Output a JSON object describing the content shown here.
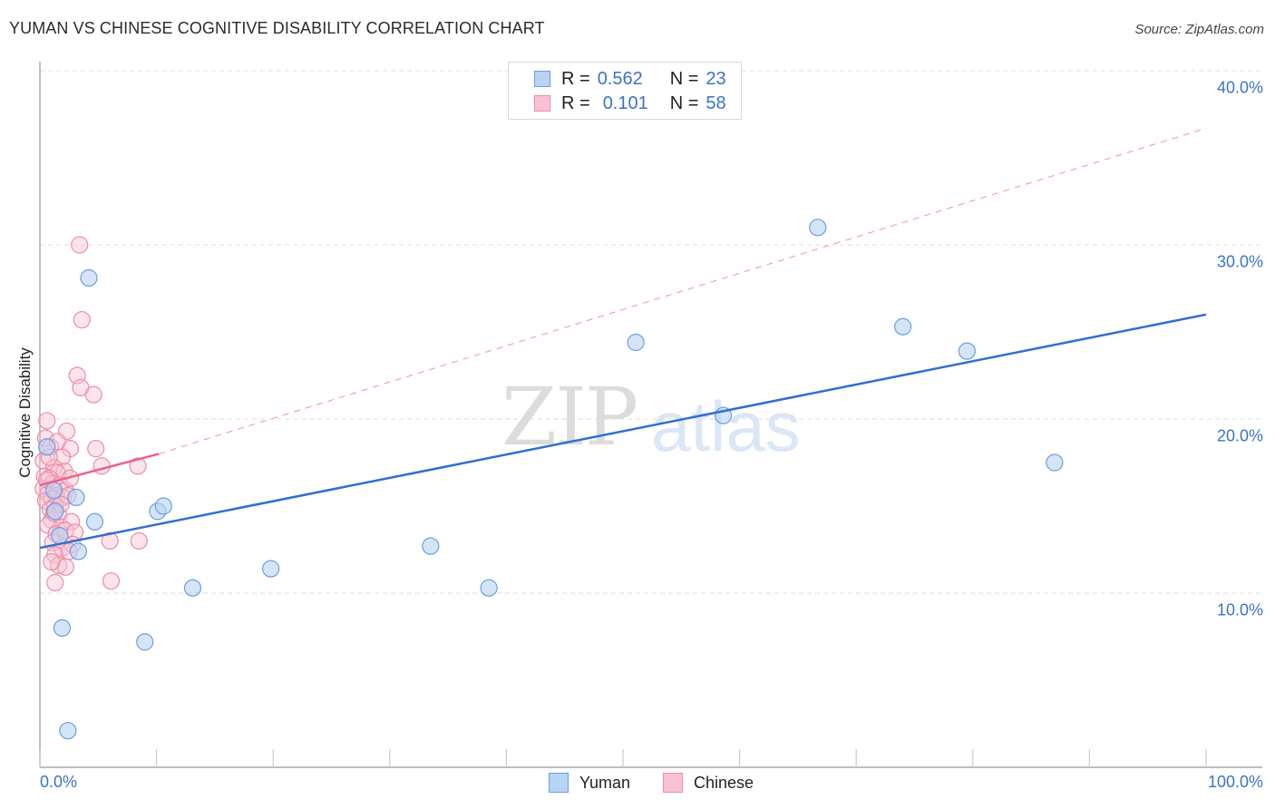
{
  "header": {
    "title": "YUMAN VS CHINESE COGNITIVE DISABILITY CORRELATION CHART",
    "source": "Source: ZipAtlas.com"
  },
  "watermark": {
    "zip": "ZIP",
    "atlas": "atlas"
  },
  "colors": {
    "yuman_fill": "#b9d3f3",
    "yuman_stroke": "#6a9ee0",
    "yuman_line": "#2f6fd0",
    "chinese_fill": "#f7c3d2",
    "chinese_stroke": "#ec8ca8",
    "chinese_line": "#e8638a",
    "axis_text": "#3b73c8",
    "grid": "#dddddd"
  },
  "legend": {
    "rows": [
      {
        "series": "Yuman",
        "r_label": "R =",
        "r_value": "0.562",
        "n_label": "N =",
        "n_value": "23"
      },
      {
        "series": "Chinese",
        "r_label": "R =",
        "r_value": "0.101",
        "n_label": "N =",
        "n_value": "58"
      }
    ]
  },
  "bottom_legend": [
    "Yuman",
    "Chinese"
  ],
  "chart_data": {
    "type": "scatter",
    "title": "YUMAN VS CHINESE COGNITIVE DISABILITY CORRELATION CHART",
    "xlabel": "",
    "ylabel": "Cognitive Disability",
    "xlim": [
      0,
      100
    ],
    "ylim": [
      0,
      42
    ],
    "x_tick_labels": [
      "0.0%",
      "100.0%"
    ],
    "x_minor_ticks": [
      0,
      10,
      20,
      30,
      40,
      50,
      60,
      70,
      80,
      90,
      100
    ],
    "y_ticks": [
      10,
      20,
      30,
      40
    ],
    "y_tick_labels": [
      "10.0%",
      "20.0%",
      "30.0%",
      "40.0%"
    ],
    "grid": "horizontal-dashed",
    "legend_placement": "top-center",
    "series": [
      {
        "name": "Yuman",
        "r": 0.562,
        "n": 23,
        "points": [
          [
            4.2,
            28.1
          ],
          [
            3.1,
            15.5
          ],
          [
            1.3,
            14.7
          ],
          [
            4.7,
            14.1
          ],
          [
            3.3,
            12.4
          ],
          [
            1.7,
            13.3
          ],
          [
            1.9,
            8.0
          ],
          [
            2.4,
            2.1
          ],
          [
            9.0,
            7.2
          ],
          [
            10.1,
            14.7
          ],
          [
            10.6,
            15.0
          ],
          [
            13.1,
            10.3
          ],
          [
            19.8,
            11.4
          ],
          [
            33.5,
            12.7
          ],
          [
            38.5,
            10.3
          ],
          [
            51.1,
            24.4
          ],
          [
            58.6,
            20.2
          ],
          [
            66.7,
            31.0
          ],
          [
            74.0,
            25.3
          ],
          [
            79.5,
            23.9
          ],
          [
            87.0,
            17.5
          ],
          [
            0.6,
            18.4
          ],
          [
            1.2,
            15.9
          ]
        ],
        "trend": {
          "x": [
            0,
            100
          ],
          "y": [
            12.6,
            26.0
          ],
          "style": "solid"
        }
      },
      {
        "name": "Chinese",
        "r": 0.101,
        "n": 58,
        "points": [
          [
            3.4,
            30.0
          ],
          [
            3.6,
            25.7
          ],
          [
            3.2,
            22.5
          ],
          [
            3.5,
            21.8
          ],
          [
            4.6,
            21.4
          ],
          [
            0.6,
            19.9
          ],
          [
            2.3,
            19.3
          ],
          [
            0.5,
            18.9
          ],
          [
            0.9,
            18.4
          ],
          [
            2.6,
            18.3
          ],
          [
            4.8,
            18.3
          ],
          [
            0.3,
            17.6
          ],
          [
            1.9,
            17.8
          ],
          [
            1.2,
            17.2
          ],
          [
            2.1,
            17.0
          ],
          [
            1.5,
            16.9
          ],
          [
            0.4,
            16.7
          ],
          [
            0.8,
            16.6
          ],
          [
            1.1,
            16.3
          ],
          [
            0.3,
            16.0
          ],
          [
            1.7,
            16.2
          ],
          [
            2.2,
            15.9
          ],
          [
            0.7,
            15.7
          ],
          [
            1.4,
            15.6
          ],
          [
            1.0,
            15.4
          ],
          [
            2.0,
            15.5
          ],
          [
            0.5,
            15.3
          ],
          [
            1.3,
            15.0
          ],
          [
            2.4,
            15.6
          ],
          [
            0.9,
            14.8
          ],
          [
            1.6,
            14.5
          ],
          [
            1.0,
            14.2
          ],
          [
            1.8,
            13.8
          ],
          [
            2.7,
            14.1
          ],
          [
            0.7,
            13.9
          ],
          [
            1.4,
            13.4
          ],
          [
            2.2,
            13.6
          ],
          [
            3.0,
            13.5
          ],
          [
            1.1,
            12.9
          ],
          [
            1.9,
            12.6
          ],
          [
            2.8,
            12.8
          ],
          [
            1.3,
            12.2
          ],
          [
            2.5,
            12.4
          ],
          [
            1.6,
            11.6
          ],
          [
            2.2,
            11.5
          ],
          [
            1.0,
            11.8
          ],
          [
            1.3,
            10.6
          ],
          [
            6.0,
            13.0
          ],
          [
            8.5,
            13.0
          ],
          [
            6.1,
            10.7
          ],
          [
            8.4,
            17.3
          ],
          [
            5.3,
            17.3
          ],
          [
            0.8,
            17.8
          ],
          [
            1.5,
            18.7
          ],
          [
            0.6,
            16.5
          ],
          [
            2.6,
            16.6
          ],
          [
            1.2,
            14.6
          ],
          [
            1.8,
            15.1
          ]
        ],
        "trend": {
          "x": [
            0,
            10.2
          ],
          "y": [
            16.2,
            18.0
          ],
          "style": "solid",
          "extended": {
            "x": [
              10.2,
              100
            ],
            "y": [
              18.0,
              36.7
            ],
            "style": "dashed"
          }
        }
      }
    ]
  }
}
